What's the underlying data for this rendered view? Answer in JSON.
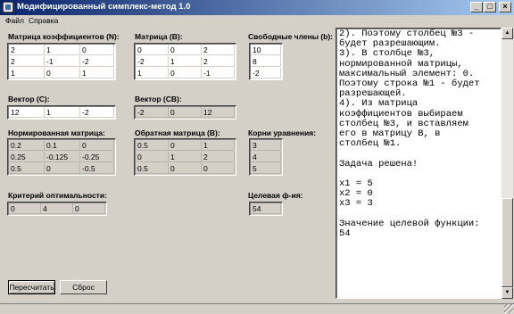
{
  "window": {
    "title": "Модифицированный симплекс-метод 1.0",
    "min": "_",
    "max": "□",
    "close": "×"
  },
  "menu": [
    "Файл",
    "Справка"
  ],
  "labels": {
    "coef_matrix": "Матрица коэффициентов (N):",
    "matrix_b": "Матрица (B):",
    "free_terms": "Свободные члены (b):",
    "vector_c": "Вектор (C):",
    "vector_cb": "Вектор (CB):",
    "norm_matrix": "Нормированная матрица:",
    "inverse_matrix": "Обратная матрица (B):",
    "roots": "Корни уравнения:",
    "criterion": "Критерий оптимальности:",
    "objective": "Целевая ф-ия:"
  },
  "coef_matrix": [
    [
      "2",
      "1",
      "0"
    ],
    [
      "2",
      "-1",
      "-2"
    ],
    [
      "1",
      "0",
      "1"
    ]
  ],
  "matrix_b": [
    [
      "0",
      "0",
      "2"
    ],
    [
      "-2",
      "1",
      "2"
    ],
    [
      "1",
      "0",
      "-1"
    ]
  ],
  "free_terms": [
    "10",
    "8",
    "-2"
  ],
  "vector_c": [
    "12",
    "1",
    "-2"
  ],
  "vector_cb": [
    "-2",
    "0",
    "12"
  ],
  "norm_matrix": [
    [
      "0.2",
      "0.1",
      "0"
    ],
    [
      "0.25",
      "-0.125",
      "-0.25"
    ],
    [
      "0.5",
      "0",
      "-0.5"
    ]
  ],
  "inverse_matrix": [
    [
      "0.5",
      "0",
      "1"
    ],
    [
      "0",
      "1",
      "2"
    ],
    [
      "0.5",
      "0",
      "0"
    ]
  ],
  "roots": [
    "3",
    "4",
    "5"
  ],
  "criterion": [
    "0",
    "4",
    "0"
  ],
  "objective": "54",
  "output_text": "2). Поэтому столбец №3 -\nбудет разрешающим.\n3). В столбце №3,\nнормированной матрицы,\nмаксимальный элемент: 0.\nПоэтому строка №1 - будет\nразрешающей.\n4). Из матрица\nкоэффициентов выбираем\nстолбец №3, и вставляем\nего в матрицу B, в\nстолбец №1.\n\nЗадача решена!\n\nx1 = 5\nx2 = 0\nx3 = 3\n\nЗначение целевой функции:\n54",
  "buttons": {
    "recalc": "Пересчитать",
    "reset": "Сброс"
  },
  "icons": {
    "app": "app-icon",
    "scroll_up": "arrow-up-icon",
    "scroll_down": "arrow-down-icon"
  }
}
